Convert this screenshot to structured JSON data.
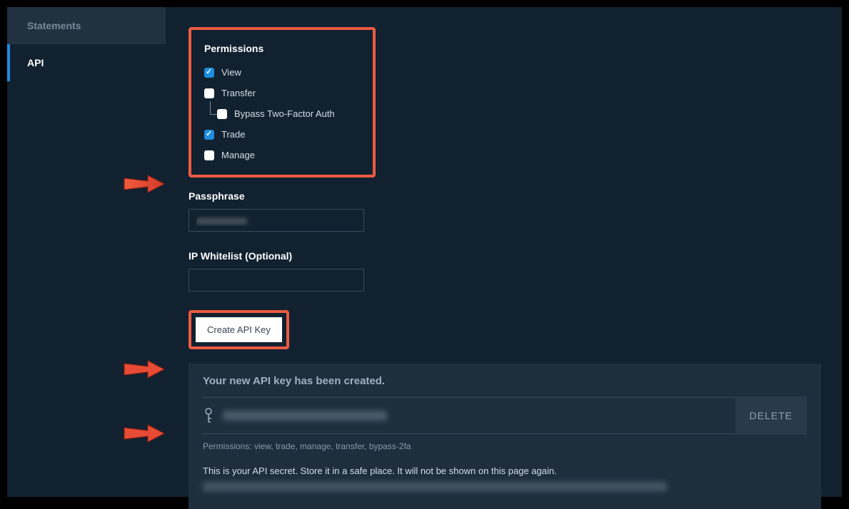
{
  "sidebar": {
    "items": [
      {
        "label": "Statements"
      },
      {
        "label": "API"
      }
    ]
  },
  "permissions": {
    "title": "Permissions",
    "options": {
      "view": "View",
      "transfer": "Transfer",
      "bypass2fa": "Bypass Two-Factor Auth",
      "trade": "Trade",
      "manage": "Manage"
    }
  },
  "passphrase": {
    "label": "Passphrase",
    "value": "●●●●●●●●●"
  },
  "whitelist": {
    "label": "IP Whitelist (Optional)",
    "value": ""
  },
  "actions": {
    "create": "Create API Key",
    "delete": "DELETE"
  },
  "result": {
    "title": "Your new API key has been created.",
    "permissions_text": "Permissions: view, trade, manage, transfer, bypass-2fa",
    "secret_label": "This is your API secret. Store it in a safe place. It will not be shown on this page again."
  },
  "colors": {
    "highlight": "#eb5a41",
    "accent": "#1d8de0",
    "bg": "#12212f"
  }
}
